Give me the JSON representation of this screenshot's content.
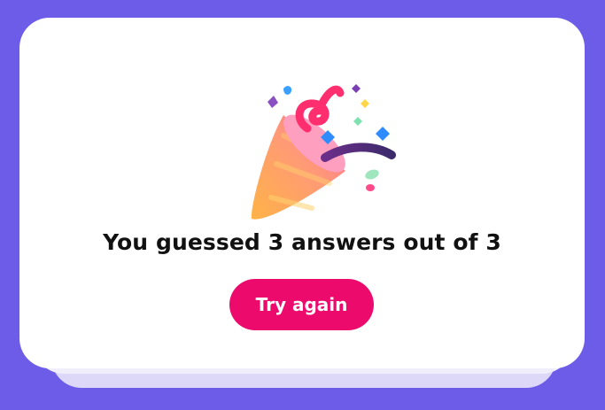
{
  "result": {
    "message": "You guessed 3 answers out of 3",
    "illustration_icon": "party-popper-icon"
  },
  "actions": {
    "try_again_label": "Try again"
  },
  "colors": {
    "background": "#6c5ce7",
    "card": "#ffffff",
    "button": "#ec0b6c",
    "button_text": "#ffffff",
    "text": "#111111"
  }
}
